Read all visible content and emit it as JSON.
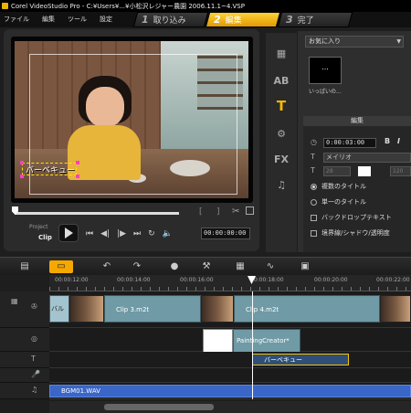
{
  "window": {
    "title": "Corel VideoStudio Pro - C:¥Users¥...¥小松沢レジャー農園 2006.11.1~4.VSP"
  },
  "menu": [
    "ファイル",
    "編集",
    "ツール",
    "設定"
  ],
  "steps": [
    {
      "num": "1",
      "label": "取り込み"
    },
    {
      "num": "2",
      "label": "編集"
    },
    {
      "num": "3",
      "label": "完了"
    }
  ],
  "preview": {
    "title_overlay_text": "バーベキュー",
    "mode_project": "Project",
    "mode_clip": "Clip",
    "mark_in": "[",
    "mark_out": "]",
    "timecode": "00:00:00:00"
  },
  "library": {
    "dropdown": "お気に入り",
    "thumb_text": "...",
    "thumb_label": "いっぱいの..."
  },
  "edit_panel": {
    "header": "編集",
    "timecode": "0:00:03:00",
    "bold": "B",
    "italic": "I",
    "font": "メイリオ",
    "size": "28",
    "opacity": "120",
    "multi_title": "複数のタイトル",
    "single_title": "単一のタイトル",
    "backdrop": "バックドロップテキスト",
    "border_shadow": "境界線/シャドウ/透明度"
  },
  "ruler": {
    "labels": [
      "00:00:12:00",
      "00:00:14:00",
      "00:00:16:00",
      "00:00:18:00",
      "00:00:20:00",
      "00:00:22:00"
    ]
  },
  "timeline": {
    "video_clips": [
      "バル",
      "Clip 3.m2t",
      "Clip 4.m2t"
    ],
    "overlay_clip": "PaintingCreator*",
    "title_clip": "バーベキュー",
    "music_clip": "BGM01.WAV"
  }
}
